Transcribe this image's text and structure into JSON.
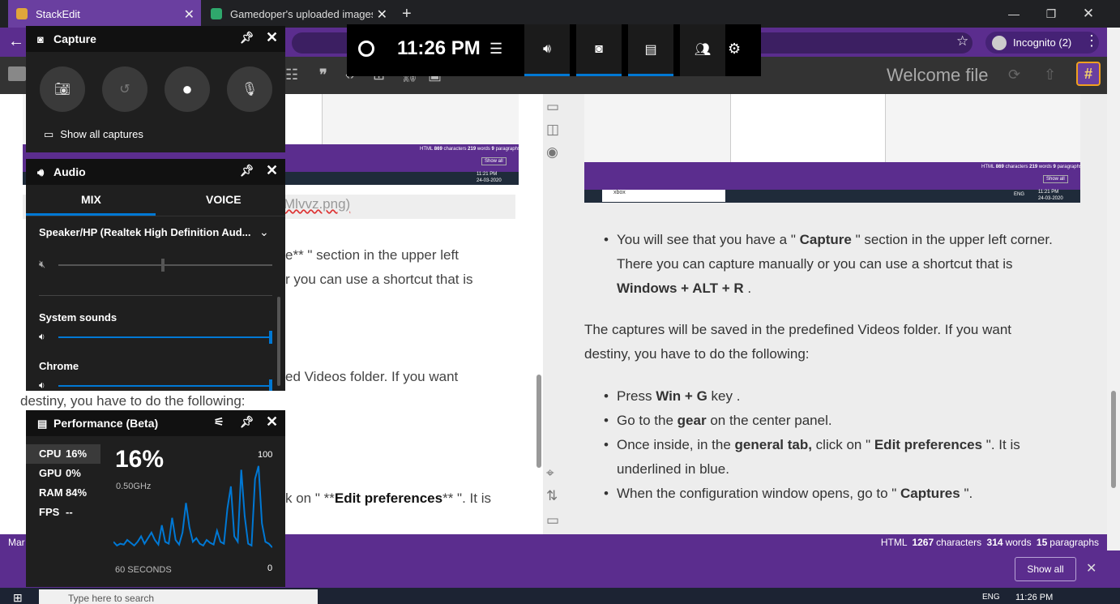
{
  "browser": {
    "tabs": [
      {
        "title": "StackEdit"
      },
      {
        "title": "Gamedoper's uploaded images -"
      }
    ],
    "new_tab": "+",
    "incognito_label": "Incognito (2)"
  },
  "stackedit": {
    "doc_title": "Welcome file",
    "editor": {
      "link_tail": "Mlvvz.png)",
      "line1_end": "e** \" section in the upper left",
      "line2_end": "r you can use a shortcut that is",
      "line3_end": "ed Videos folder. If you want",
      "line4": "destiny, you have to do the following:",
      "line5_pre": "k on \" **",
      "line5_bold": "Edit preferences",
      "line5_post": "** \". It is"
    },
    "embedded_status": {
      "lang": "HTML",
      "chars": "869",
      "chars_label": "characters",
      "words": "219",
      "words_label": "words",
      "paras": "9",
      "paras_label": "paragraphs",
      "show_all": "Show all",
      "search": "xbox",
      "time": "11:21 PM",
      "date": "24-03-2020",
      "lang_code": "ENG"
    },
    "preview": {
      "bullet1_a": "You will see that you have a \" ",
      "bullet1_b": "Capture",
      "bullet1_c": " \" section in the upper left corner.",
      "bullet1_l2": "There you can capture manually or you can use a shortcut that is",
      "bullet1_l3": "Windows + ALT + R",
      "bullet1_l3_tail": " .",
      "para1_l1": "The captures will be saved in the predefined Videos folder. If you want",
      "para1_l2": "destiny, you have to do the following:",
      "steps": [
        {
          "pre": "Press ",
          "bold": "Win + G",
          "post": " key ."
        },
        {
          "pre": "Go to the ",
          "bold": "gear",
          "post": " on the center panel."
        },
        {
          "pre": "Once inside, in the ",
          "bold": "general tab,",
          "post": " click on \" ",
          "bold2": "Edit preferences",
          "post2": " \". It is"
        },
        {
          "pre": "When the configuration window opens, go to \" ",
          "bold": "Captures",
          "post": " \"."
        }
      ],
      "step3_l2": "underlined in blue."
    },
    "status": {
      "left": "Mar",
      "lang": "HTML",
      "chars": "1267",
      "chars_label": "characters",
      "words": "314",
      "words_label": "words",
      "paras": "15",
      "paras_label": "paragraphs"
    }
  },
  "notification": {
    "show_all": "Show all"
  },
  "taskbar": {
    "search_placeholder": "Type here to search",
    "time": "11:26 PM",
    "lang": "ENG"
  },
  "gamebar": {
    "time": "11:26 PM",
    "capture": {
      "title": "Capture",
      "show_all": "Show all captures"
    },
    "audio": {
      "title": "Audio",
      "tabs": [
        "MIX",
        "VOICE"
      ],
      "device": "Speaker/HP (Realtek High Definition Aud...",
      "master_level": 0.49,
      "apps": [
        {
          "name": "System sounds",
          "level": 1.0
        },
        {
          "name": "Chrome",
          "level": 1.0
        }
      ]
    },
    "performance": {
      "title": "Performance (Beta)",
      "stats": [
        {
          "label": "CPU",
          "value": "16%"
        },
        {
          "label": "GPU",
          "value": "0%"
        },
        {
          "label": "RAM",
          "value": "84%"
        },
        {
          "label": "FPS",
          "value": "--"
        }
      ],
      "big_value": "16%",
      "freq": "0.50GHz",
      "max_label": "100",
      "min_label": "0",
      "duration_label": "60 SECONDS",
      "cpu_series": [
        12,
        8,
        10,
        9,
        14,
        11,
        8,
        12,
        18,
        10,
        16,
        22,
        14,
        9,
        30,
        12,
        10,
        38,
        14,
        9,
        22,
        54,
        28,
        12,
        16,
        10,
        8,
        14,
        11,
        9,
        24,
        12,
        10,
        48,
        72,
        18,
        12,
        90,
        40,
        10,
        8,
        80,
        94,
        32,
        12,
        10,
        6
      ]
    },
    "colors": {
      "accent": "#0078d4"
    }
  }
}
